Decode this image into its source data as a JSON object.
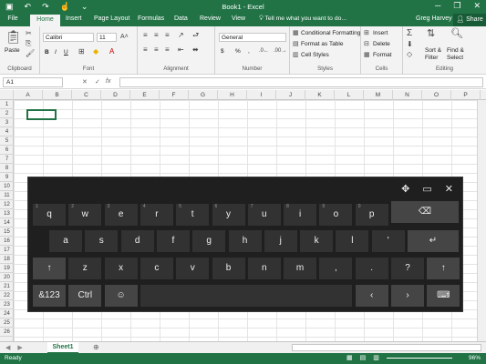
{
  "window": {
    "title": "Book1 - Excel",
    "minimize": "─",
    "restore": "❐",
    "close": "✕"
  },
  "qat": {
    "save_icon": "save-icon",
    "undo": "↶",
    "redo": "↷",
    "touch": "☝",
    "more": "⌄"
  },
  "tabs": [
    "File",
    "Home",
    "Insert",
    "Page Layout",
    "Formulas",
    "Data",
    "Review",
    "View"
  ],
  "tellme": "Tell me what you want to do...",
  "user": "Greg Harvey",
  "share": "Share",
  "ribbon": {
    "clipboard": {
      "paste": "Paste",
      "label": "Clipboard"
    },
    "font": {
      "name": "Calibri",
      "size": "11",
      "bold": "B",
      "italic": "I",
      "underline": "U",
      "label": "Font"
    },
    "alignment": {
      "label": "Alignment"
    },
    "number": {
      "format": "General",
      "currency": "$",
      "percent": "%",
      "comma": ",",
      "label": "Number"
    },
    "styles": {
      "conditional": "Conditional Formatting",
      "table": "Format as Table",
      "cell": "Cell Styles",
      "label": "Styles"
    },
    "cells": {
      "insert": "Insert",
      "delete": "Delete",
      "format": "Format",
      "label": "Cells"
    },
    "editing": {
      "sigma": "Σ",
      "sort": "Sort &",
      "filter": "Filter",
      "find": "Find &",
      "select": "Select",
      "label": "Editing"
    }
  },
  "formula_bar": {
    "namebox": "A1",
    "cancel": "✕",
    "enter": "✓",
    "fx": "fx",
    "value": ""
  },
  "columns": [
    "A",
    "B",
    "C",
    "D",
    "E",
    "F",
    "G",
    "H",
    "I",
    "J",
    "K",
    "L",
    "M",
    "N",
    "O",
    "P"
  ],
  "rows": [
    "1",
    "2",
    "3",
    "4",
    "5",
    "6",
    "7",
    "8",
    "9",
    "10",
    "11",
    "12",
    "13",
    "14",
    "15",
    "16",
    "17",
    "18",
    "19",
    "20",
    "21",
    "22",
    "23",
    "24",
    "25",
    "26"
  ],
  "keyboard": {
    "controls": {
      "move": "✥",
      "dock": "▭",
      "close": "✕"
    },
    "row1": [
      [
        "q",
        "1"
      ],
      [
        "w",
        "2"
      ],
      [
        "e",
        "3"
      ],
      [
        "r",
        "4"
      ],
      [
        "t",
        "5"
      ],
      [
        "y",
        "6"
      ],
      [
        "u",
        "7"
      ],
      [
        "i",
        "8"
      ],
      [
        "o",
        "9"
      ],
      [
        "p",
        "0"
      ]
    ],
    "backspace": "⌫",
    "row2": [
      "a",
      "s",
      "d",
      "f",
      "g",
      "h",
      "j",
      "k",
      "l",
      "'"
    ],
    "enter": "↵",
    "shift": "↑",
    "row3": [
      "z",
      "x",
      "c",
      "v",
      "b",
      "n",
      "m",
      ",",
      ".",
      "?"
    ],
    "symbols": "&123",
    "ctrl": "Ctrl",
    "emoji": "☺",
    "left": "‹",
    "right": "›",
    "kbmenu": "⌨"
  },
  "sheet_tabs": {
    "name": "Sheet1",
    "add": "⊕",
    "prev": "◀",
    "next": "▶"
  },
  "status": {
    "ready": "Ready",
    "zoom": "96%"
  }
}
